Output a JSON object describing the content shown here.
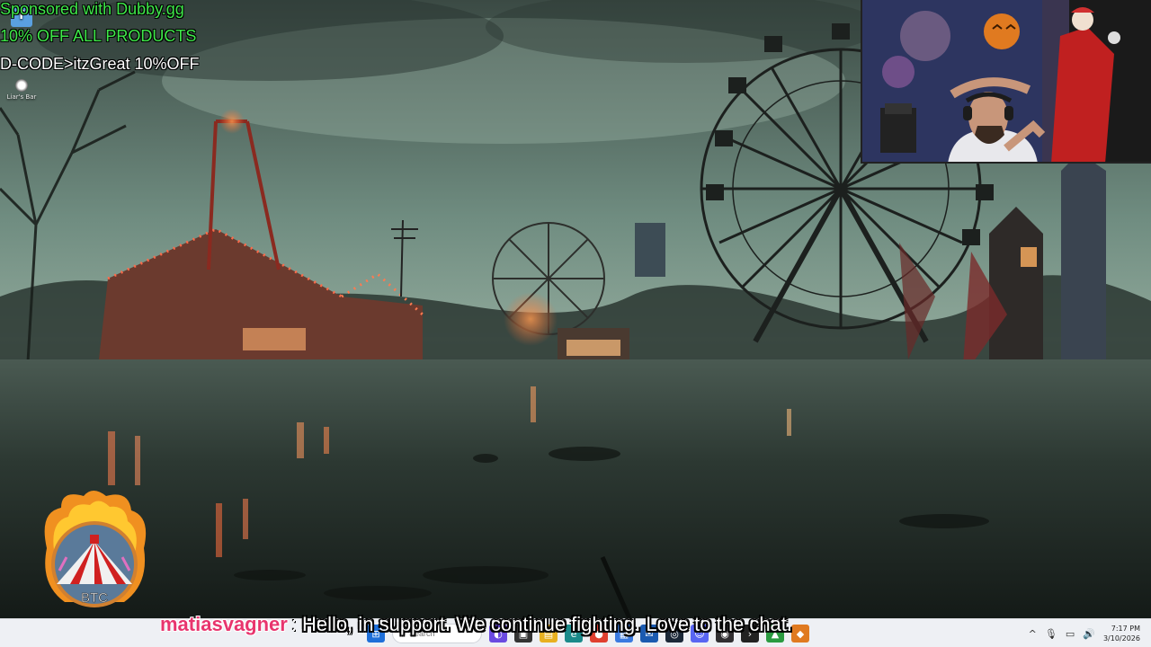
{
  "sponsor": {
    "line1": "Sponsored with Dubby.gg",
    "line2": "10% OFF ALL PRODUCTS",
    "line3": "D-CODE>itzGreat 10%OFF"
  },
  "desktop_icons": [
    {
      "label": "",
      "icon": "app-shortcut-icon"
    },
    {
      "label": "Liar's Bar",
      "icon": "liars-bar-icon"
    }
  ],
  "logo": {
    "text": "BTC"
  },
  "chat": {
    "username": "matiasvagner",
    "separator": ":",
    "message": "Hello, in support. We continue fighting. Love to the chat."
  },
  "taskbar": {
    "search_placeholder": "Search",
    "apps": [
      "start-icon",
      "search-box",
      "widgets-icon",
      "task-view-icon",
      "file-explorer-icon",
      "edge-icon",
      "chrome-icon",
      "store-icon",
      "mail-icon",
      "steam-icon",
      "discord-icon",
      "obs-icon",
      "terminal-icon",
      "game-icon",
      "browser-icon"
    ],
    "tray": {
      "chevron": "^",
      "time": "7:17 PM",
      "date": "3/10/2026"
    }
  },
  "colors": {
    "sponsor_green": "#3fe84a",
    "chat_username": "#e8356e",
    "taskbar_bg": "#eef0f4"
  }
}
